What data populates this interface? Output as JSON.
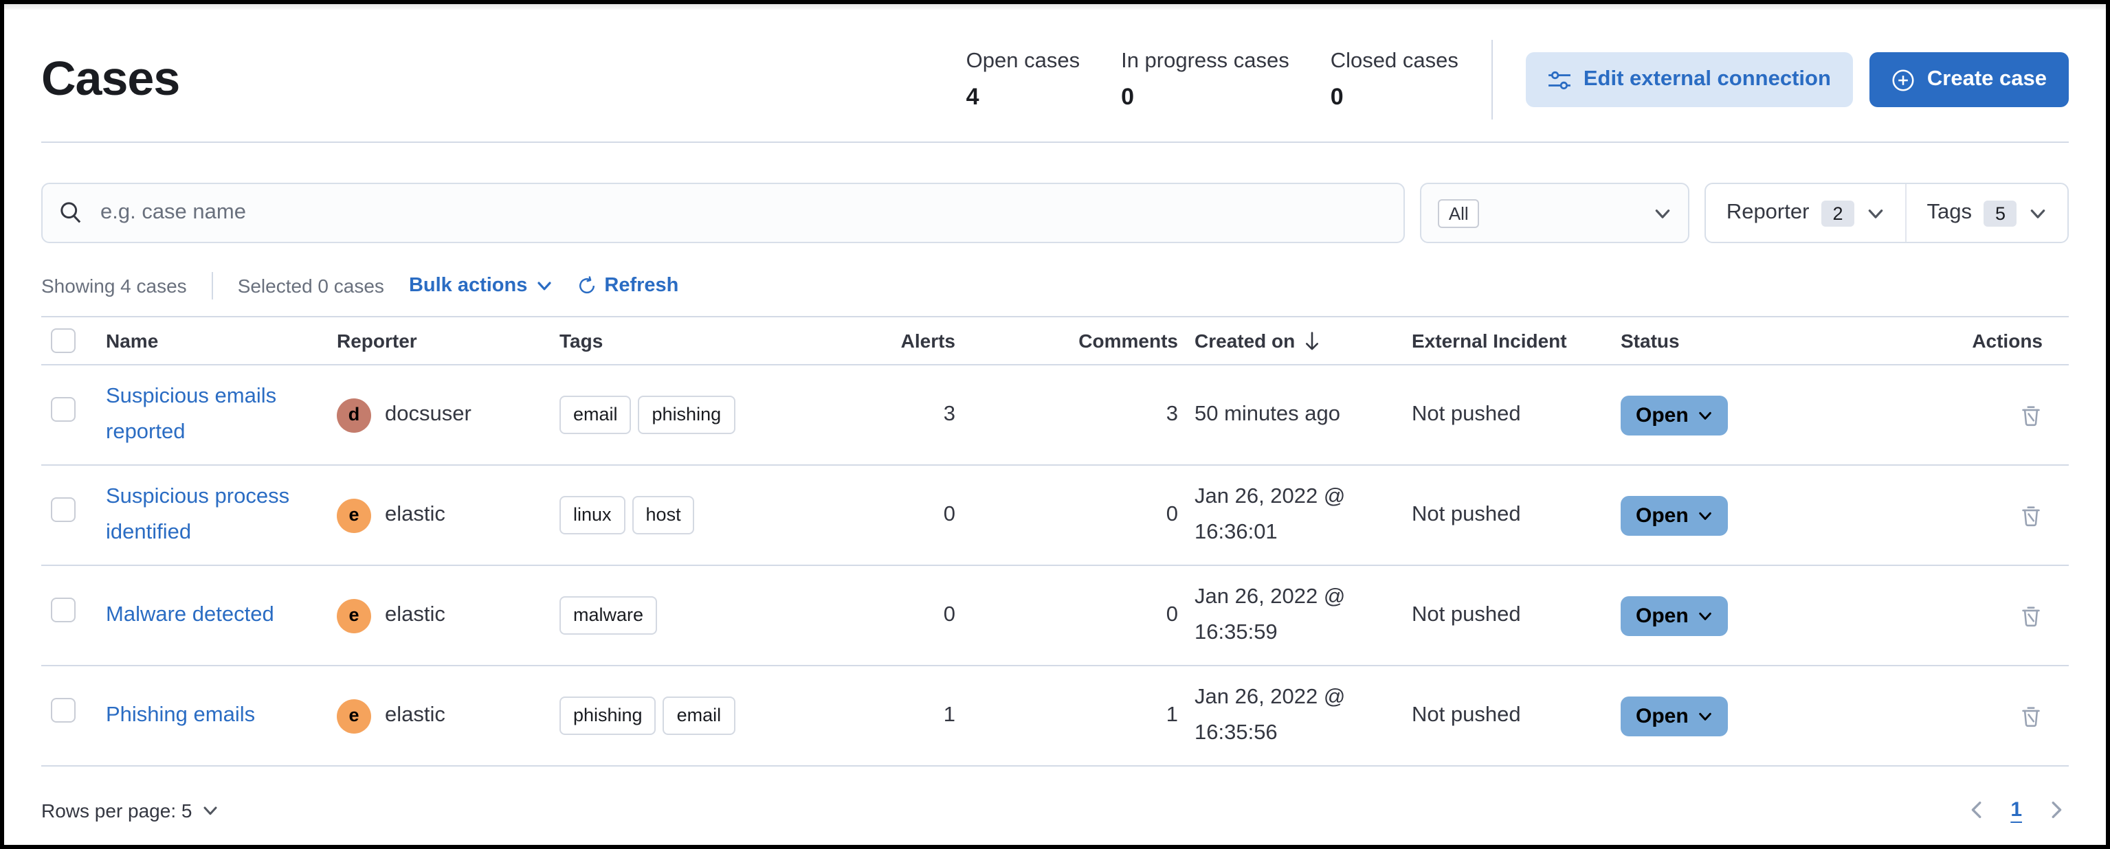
{
  "header": {
    "title": "Cases",
    "stats": [
      {
        "label": "Open cases",
        "value": "4"
      },
      {
        "label": "In progress cases",
        "value": "0"
      },
      {
        "label": "Closed cases",
        "value": "0"
      }
    ],
    "edit_connection_label": "Edit external connection",
    "create_case_label": "Create case"
  },
  "filters": {
    "search_placeholder": "e.g. case name",
    "status_filter": {
      "selected_badge": "All"
    },
    "reporter_filter": {
      "label": "Reporter",
      "count": "2"
    },
    "tags_filter": {
      "label": "Tags",
      "count": "5"
    }
  },
  "utility_bar": {
    "showing": "Showing 4 cases",
    "selected": "Selected 0 cases",
    "bulk_actions_label": "Bulk actions",
    "refresh_label": "Refresh"
  },
  "table": {
    "columns": [
      "Name",
      "Reporter",
      "Tags",
      "Alerts",
      "Comments",
      "Created on",
      "External Incident",
      "Status",
      "Actions"
    ],
    "sorted_column": "Created on",
    "sort_direction": "desc",
    "rows": [
      {
        "name": "Suspicious emails reported",
        "reporter": {
          "initial": "d",
          "name": "docsuser",
          "color": "#c47c6c"
        },
        "tags": [
          "email",
          "phishing"
        ],
        "alerts": "3",
        "comments": "3",
        "created_on": "50 minutes ago",
        "external_incident": "Not pushed",
        "status": "Open"
      },
      {
        "name": "Suspicious process identified",
        "reporter": {
          "initial": "e",
          "name": "elastic",
          "color": "#f5a35c"
        },
        "tags": [
          "linux",
          "host"
        ],
        "alerts": "0",
        "comments": "0",
        "created_on": "Jan 26, 2022 @ 16:36:01",
        "external_incident": "Not pushed",
        "status": "Open"
      },
      {
        "name": "Malware detected",
        "reporter": {
          "initial": "e",
          "name": "elastic",
          "color": "#f5a35c"
        },
        "tags": [
          "malware"
        ],
        "alerts": "0",
        "comments": "0",
        "created_on": "Jan 26, 2022 @ 16:35:59",
        "external_incident": "Not pushed",
        "status": "Open"
      },
      {
        "name": "Phishing emails",
        "reporter": {
          "initial": "e",
          "name": "elastic",
          "color": "#f5a35c"
        },
        "tags": [
          "phishing",
          "email"
        ],
        "alerts": "1",
        "comments": "1",
        "created_on": "Jan 26, 2022 @ 16:35:56",
        "external_incident": "Not pushed",
        "status": "Open"
      }
    ]
  },
  "footer": {
    "rows_per_page": "Rows per page: 5",
    "current_page": "1"
  },
  "colors": {
    "primary": "#2a6cc3",
    "link": "#2a6cc3",
    "light_button_bg": "#d9e6f6",
    "open_badge_bg": "#79aad9",
    "border": "#d3dae6",
    "subdued": "#69707d",
    "icon_gray": "#98a2b3",
    "count_badge_bg": "#e0e4ec",
    "input_bg": "#fbfcfd"
  }
}
